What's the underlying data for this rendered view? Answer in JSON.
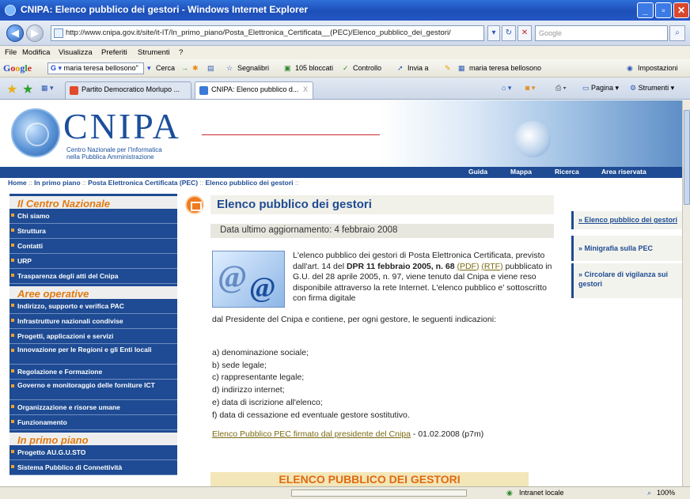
{
  "window": {
    "title": "CNIPA: Elenco pubblico dei gestori - Windows Internet Explorer"
  },
  "address": {
    "url": "http://www.cnipa.gov.it/site/it-IT/In_primo_piano/Posta_Elettronica_Certificata__(PEC)/Elenco_pubblico_dei_gestori/",
    "search_placeholder": "Google"
  },
  "menu": [
    "File",
    "Modifica",
    "Visualizza",
    "Preferiti",
    "Strumenti",
    "?"
  ],
  "google_toolbar": {
    "query": "maria teresa bellosono\"",
    "search_label": "Cerca",
    "bookmarks": "Segnalibri",
    "blocked": "105 bloccati",
    "check": "Controllo",
    "send": "Invia a",
    "profile": "maria teresa bellosono",
    "settings": "Impostazioni"
  },
  "tabs": [
    {
      "label": "Partito Democratico Morlupo ..."
    },
    {
      "label": "CNIPA: Elenco pubblico d...",
      "close": "X"
    }
  ],
  "commands": {
    "page": "Pagina",
    "tools": "Strumenti"
  },
  "banner": {
    "logo": "CNIPA",
    "subtitle1": "Centro Nazionale per l'Informatica",
    "subtitle2": "nella Pubblica Amministrazione"
  },
  "topnav": [
    "Guida",
    "Mappa",
    "Ricerca",
    "Area riservata"
  ],
  "breadcrumb": [
    "Home",
    "In primo piano",
    "Posta Elettronica Certificata (PEC)",
    "Elenco pubblico dei gestori"
  ],
  "breadcrumb_sep": "::",
  "left": {
    "sec1": "Il Centro Nazionale",
    "sec1_items": [
      "Chi siamo",
      "Struttura",
      "Contatti",
      "URP",
      "Trasparenza degli atti del Cnipa"
    ],
    "sec2": "Aree operative",
    "sec2_items": [
      "Indirizzo, supporto e verifica PAC",
      "Infrastrutture nazionali condivise",
      "Progetti, applicazioni e servizi",
      "Innovazione per le Regioni e gli Enti locali",
      "Regolazione e Formazione",
      "Governo e monitoraggio delle forniture ICT",
      "Organizzazione e risorse umane",
      "Funzionamento"
    ],
    "sec3": "In primo piano",
    "sec3_items": [
      "Progetto AU.G.U.STO",
      "Sistema Pubblico di Connettività"
    ]
  },
  "main": {
    "title": "Elenco pubblico dei gestori",
    "date": "Data ultimo aggiornamento: 4 febbraio 2008",
    "intro_a": "L'elenco pubblico dei gestori di Posta Elettronica Certificata, previsto dall'art. 14 del ",
    "intro_dpr": "DPR 11 febbraio 2005, n. 68",
    "pdf": "(PDF)",
    "rtf": "(RTF)",
    "intro_b": " pubblicato in G.U. del 28 aprile 2005, n. 97, viene tenuto dal Cnipa e viene reso disponibile attraverso la rete Internet. L'elenco pubblico e' sottoscritto con firma digitale",
    "intro_c": "dal Presidente del Cnipa e contiene, per ogni gestore, le seguenti indicazioni:",
    "list": [
      "a) denominazione sociale;",
      "b) sede legale;",
      "c) rappresentante legale;",
      "d) indirizzo internet;",
      "e) data di iscrizione all'elenco;",
      "f) data di cessazione ed eventuale gestore sostitutivo."
    ],
    "signed_link": "Elenco Pubblico PEC firmato dal presidente del Cnipa",
    "signed_tail": " - 01.02.2008 (p7m)",
    "bigbar": "ELENCO PUBBLICO DEI GESTORI"
  },
  "right": [
    "» Elenco pubblico dei gestori",
    "» Minigrafia sulla PEC",
    "» Circolare di vigilanza sui gestori"
  ],
  "status": {
    "zone": "Intranet locale",
    "zoom": "100%"
  }
}
